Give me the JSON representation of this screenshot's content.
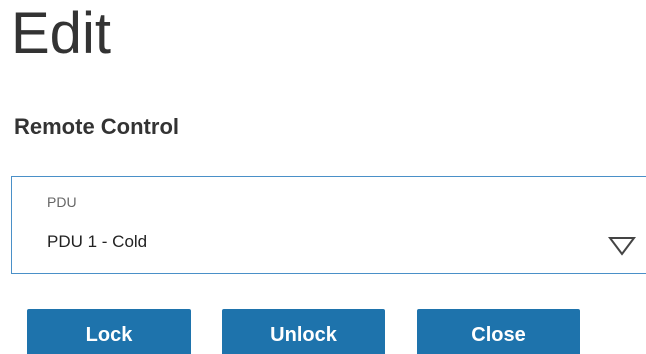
{
  "page": {
    "title": "Edit",
    "section_title": "Remote Control"
  },
  "pdu_select": {
    "label": "PDU",
    "selected_value": "PDU 1 - Cold",
    "icon": "chevron-down-icon"
  },
  "actions": {
    "lock_label": "Lock",
    "unlock_label": "Unlock",
    "close_label": "Close"
  },
  "colors": {
    "button_bg": "#1e73ac",
    "select_border": "#4a90c8",
    "title_text": "#333333"
  }
}
